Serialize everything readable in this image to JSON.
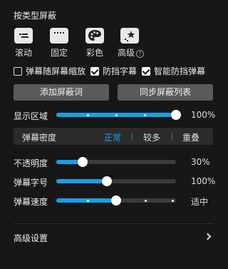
{
  "type_filter": {
    "title": "按类型屏蔽",
    "items": [
      {
        "label": "滚动",
        "icon": "scroll-danmaku-icon"
      },
      {
        "label": "固定",
        "icon": "fixed-danmaku-icon"
      },
      {
        "label": "彩色",
        "icon": "palette-icon"
      },
      {
        "label": "高级",
        "icon": "advanced-danmaku-icon",
        "help": "?"
      }
    ]
  },
  "checkboxes": [
    {
      "label": "弹幕随屏幕缩放",
      "checked": false
    },
    {
      "label": "防挡字幕",
      "checked": true
    },
    {
      "label": "智能防挡弹幕",
      "checked": true
    }
  ],
  "buttons": {
    "add_block_word": "添加屏蔽词",
    "sync_block_list": "同步屏蔽列表"
  },
  "display_area": {
    "label": "显示区域",
    "value_text": "100%",
    "fraction": 1.0
  },
  "density": {
    "label": "弹幕密度",
    "options": [
      "正常",
      "较多",
      "重叠"
    ],
    "selected": "正常",
    "accent": "#1aa3e8"
  },
  "opacity": {
    "label": "不透明度",
    "value_text": "30%",
    "fraction": 0.22
  },
  "font_size": {
    "label": "弹幕字号",
    "value_text": "100%",
    "fraction": 0.42
  },
  "speed": {
    "label": "弹幕速度",
    "value_text": "适中",
    "fraction": 0.5
  },
  "advanced": {
    "label": "高级设置"
  },
  "colors": {
    "accent": "#16a0e6",
    "panel_bg": "#171717",
    "button_bg": "#5a5a5a"
  }
}
